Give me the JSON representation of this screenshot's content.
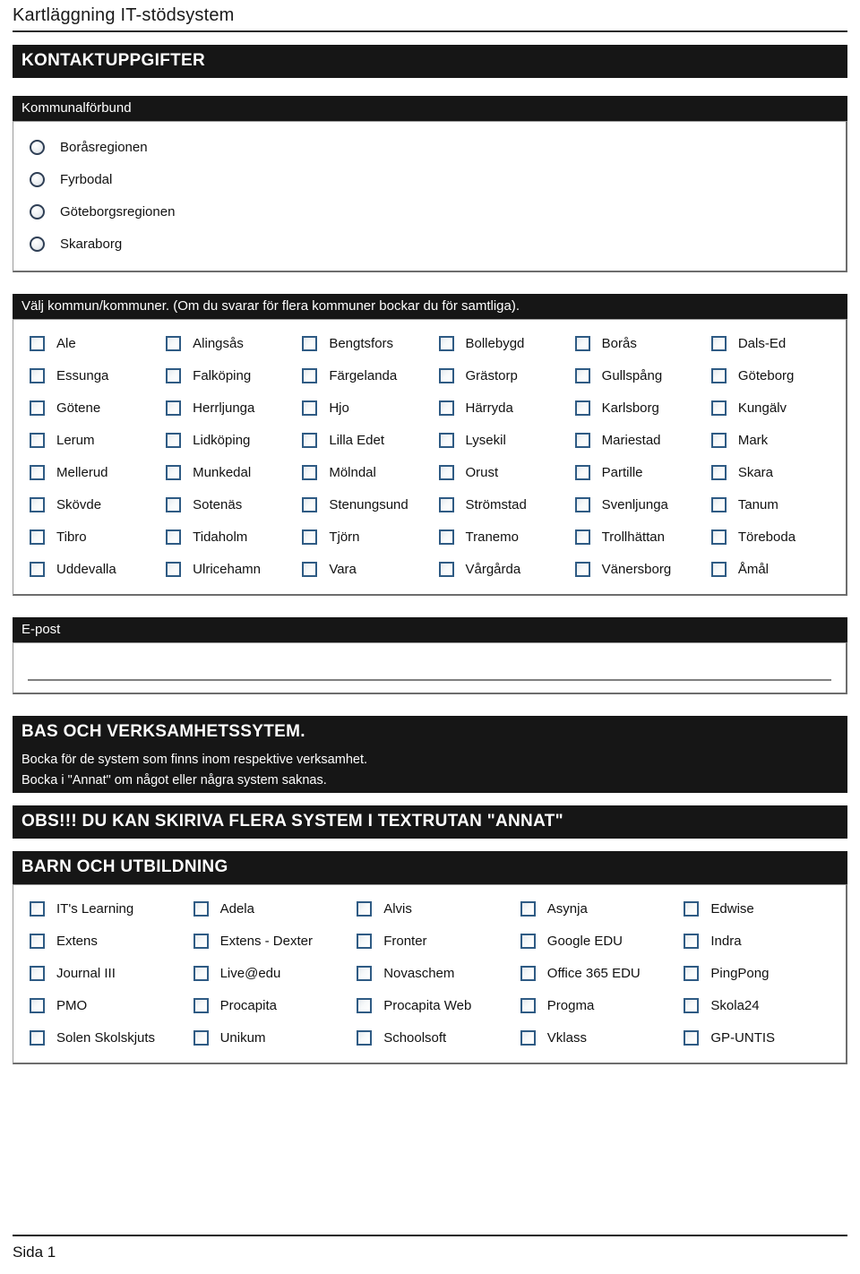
{
  "document": {
    "title": "Kartläggning IT-stödsystem",
    "footer_page": "Sida 1"
  },
  "sections": {
    "contact": {
      "heading": "KONTAKTUPPGIFTER",
      "association": {
        "legend": "Kommunalförbund",
        "options": [
          "Boråsregionen",
          "Fyrbodal",
          "Göteborgsregionen",
          "Skaraborg"
        ]
      },
      "municipalities": {
        "legend": "Välj kommun/kommuner. (Om du svarar för flera kommuner bockar du för samtliga).",
        "options": [
          "Ale",
          "Alingsås",
          "Bengtsfors",
          "Bollebygd",
          "Borås",
          "Dals-Ed",
          "Essunga",
          "Falköping",
          "Färgelanda",
          "Grästorp",
          "Gullspång",
          "Göteborg",
          "Götene",
          "Herrljunga",
          "Hjo",
          "Härryda",
          "Karlsborg",
          "Kungälv",
          "Lerum",
          "Lidköping",
          "Lilla Edet",
          "Lysekil",
          "Mariestad",
          "Mark",
          "Mellerud",
          "Munkedal",
          "Mölndal",
          "Orust",
          "Partille",
          "Skara",
          "Skövde",
          "Sotenäs",
          "Stenungsund",
          "Strömstad",
          "Svenljunga",
          "Tanum",
          "Tibro",
          "Tidaholm",
          "Tjörn",
          "Tranemo",
          "Trollhättan",
          "Töreboda",
          "Uddevalla",
          "Ulricehamn",
          "Vara",
          "Vårgårda",
          "Vänersborg",
          "Åmål"
        ]
      },
      "email": {
        "legend": "E-post",
        "value": "",
        "placeholder": ""
      }
    },
    "systems": {
      "heading": "BAS OCH VERKSAMHETSSYTEM.",
      "instruction_line1": "Bocka för de system som finns inom respektive verksamhet.",
      "instruction_line2": "Bocka i \"Annat\" om något eller några system saknas.",
      "notice": "OBS!!! DU KAN SKIRIVA FLERA SYSTEM I TEXTRUTAN \"ANNAT\""
    },
    "education": {
      "heading": "BARN OCH UTBILDNING",
      "options": [
        "IT's Learning",
        "Adela",
        "Alvis",
        "Asynja",
        "Edwise",
        "Extens",
        "Extens - Dexter",
        "Fronter",
        "Google EDU",
        "Indra",
        "Journal III",
        "Live@edu",
        "Novaschem",
        "Office 365 EDU",
        "PingPong",
        "PMO",
        "Procapita",
        "Procapita Web",
        "Progma",
        "Skola24",
        "Solen Skolskjuts",
        "Unikum",
        "Schoolsoft",
        "Vklass",
        "GP-UNTIS"
      ]
    }
  },
  "colors": {
    "bar_background": "#161616",
    "bar_text": "#ffffff",
    "checkbox_border": "#2f5b84",
    "radio_border": "#2f3f55",
    "group_border": "#9a9a9a",
    "page_background": "#ffffff"
  }
}
